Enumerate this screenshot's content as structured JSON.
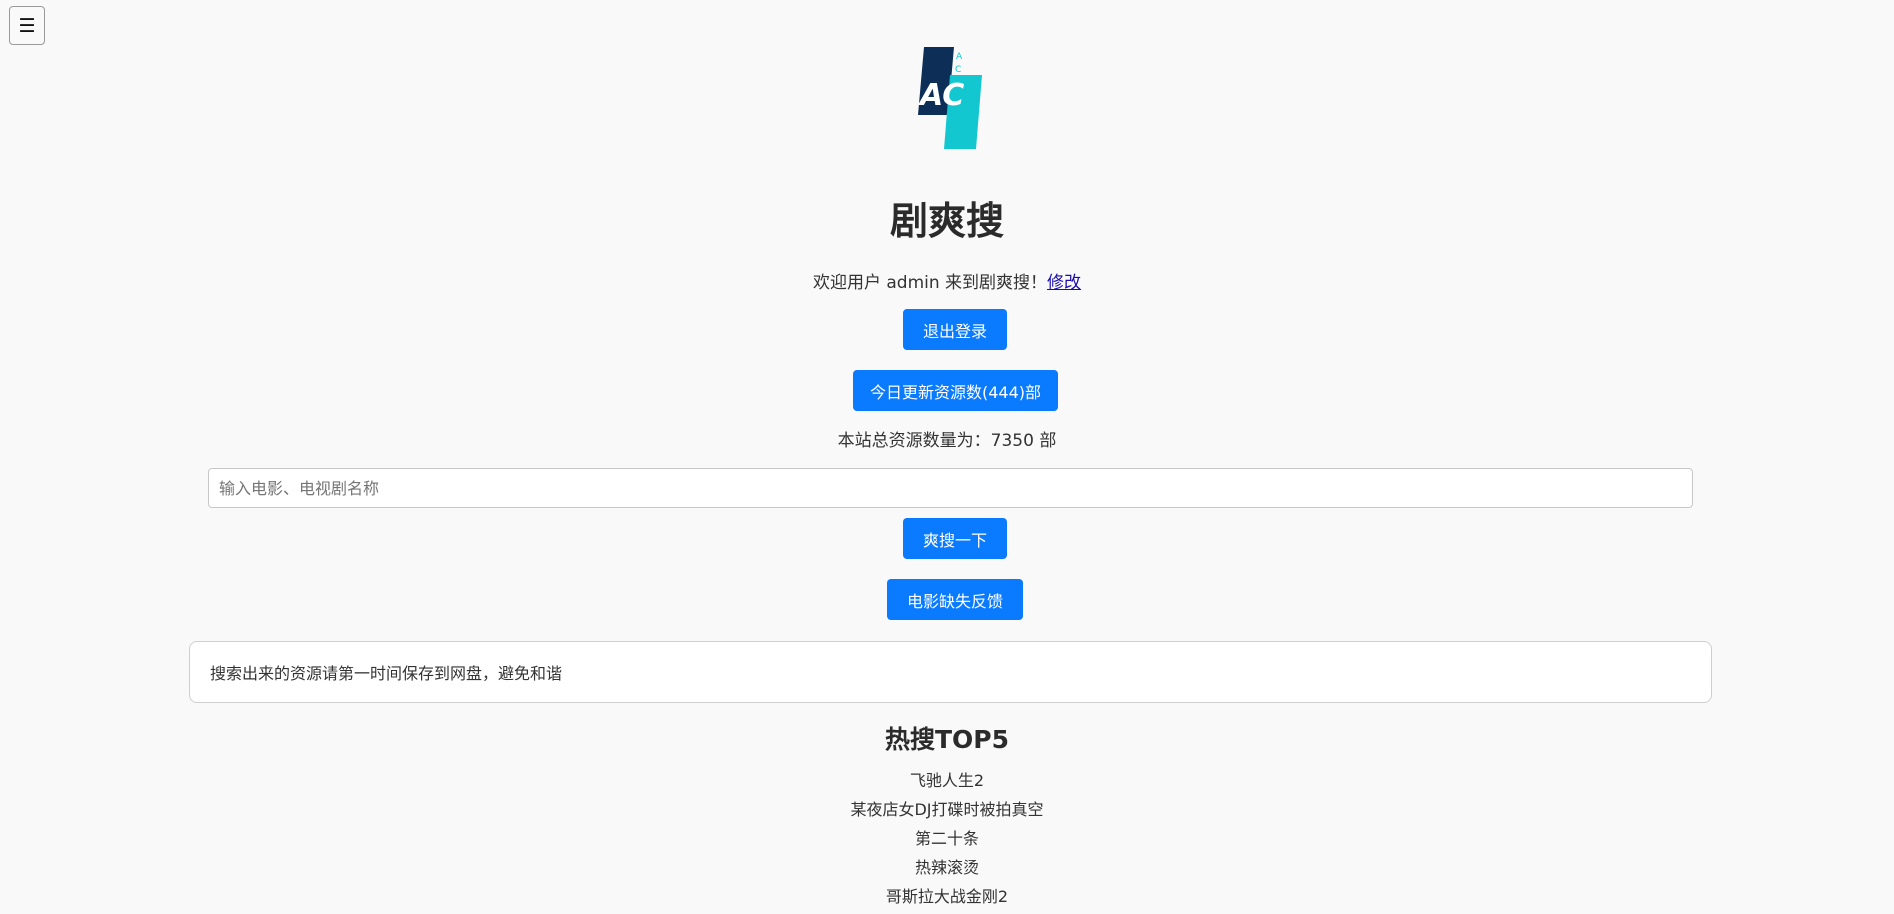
{
  "menu": {
    "icon": "hamburger-menu-icon",
    "glyph": "☰"
  },
  "logo": {
    "icon": "ac-logo-icon",
    "text": "AC",
    "small_top": "A",
    "small_bottom": "C",
    "dark_color": "#0d2f57",
    "accent_color": "#12c7cf"
  },
  "title": "剧爽搜",
  "welcome": {
    "text": "欢迎用户 admin 来到剧爽搜！",
    "edit_link": "修改"
  },
  "buttons": {
    "logout": "退出登录",
    "today_updates": "今日更新资源数(444)部",
    "search": "爽搜一下",
    "feedback": "电影缺失反馈"
  },
  "total_resources": "本站总资源数量为：7350 部",
  "search": {
    "placeholder": "输入电影、电视剧名称",
    "value": ""
  },
  "notice": "搜索出来的资源请第一时间保存到网盘，避免和谐",
  "hot": {
    "title": "热搜TOP5",
    "items": [
      "飞驰人生2",
      "某夜店女DJ打碟时被拍真空",
      "第二十条",
      "热辣滚烫",
      "哥斯拉大战金刚2"
    ]
  },
  "colors": {
    "primary": "#0a7bff",
    "background": "#f9f9f9"
  }
}
